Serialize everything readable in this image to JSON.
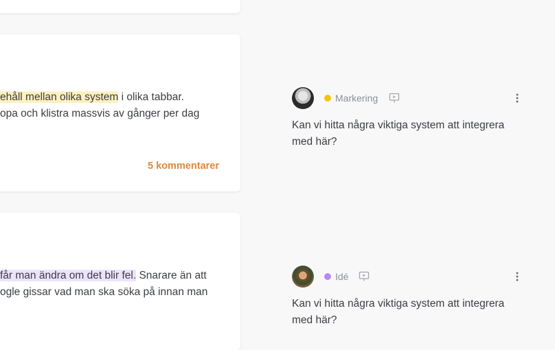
{
  "cards": [
    {},
    {
      "line1_highlight": "ehåll mellan olika system",
      "line1_rest": " i olika tabbar.",
      "line2": "opa och klistra massvis av gånger per dag",
      "comments_link": "5 kommentarer"
    },
    {
      "line1_highlight": " får man ändra om det blir fel.",
      "line1_rest": " Snarare än att",
      "line2": "ogle gissar vad man ska söka på innan man"
    }
  ],
  "comments": [
    {
      "tag_label": "Markering",
      "tag_color": "#f1c40f",
      "body": "Kan vi hitta några viktiga system att integrera med här?"
    },
    {
      "tag_label": "Idé",
      "tag_color": "#b78af2",
      "body": "Kan vi hitta några viktiga system att integrera med här?"
    }
  ],
  "icons": {
    "presentation": "presentation-icon",
    "more": "more-vertical-icon"
  }
}
